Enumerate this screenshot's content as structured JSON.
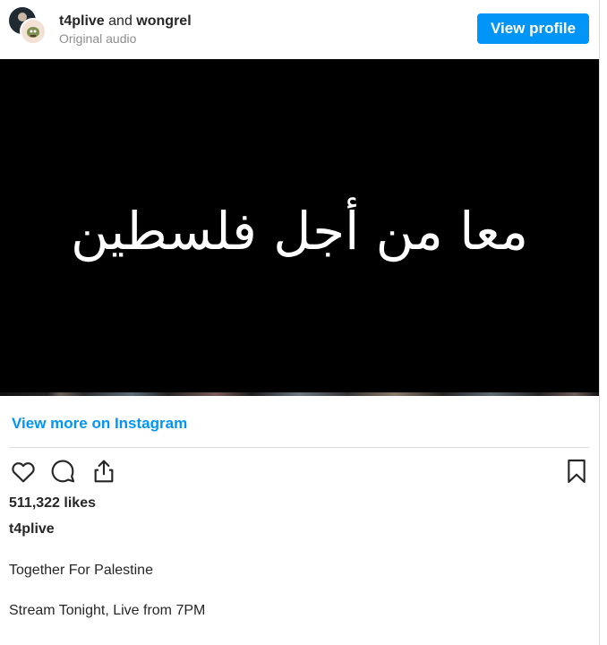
{
  "header": {
    "user1": "t4plive",
    "connector": "and",
    "user2": "wongrel",
    "subtitle": "Original audio",
    "view_profile_label": "View profile"
  },
  "media": {
    "overlay_text": "معا من أجل فلسطين"
  },
  "links": {
    "view_more": "View more on Instagram"
  },
  "actions": {
    "icons": [
      "heart-icon",
      "comment-icon",
      "share-icon",
      "bookmark-icon"
    ]
  },
  "post": {
    "likes": "511,322 likes",
    "username": "t4plive",
    "caption_lines": [
      "Together For Palestine",
      "Stream Tonight, Live from 7PM"
    ]
  },
  "colors": {
    "accent": "#0095f6",
    "text": "#262626",
    "muted": "#8e8e8e",
    "media_bg": "#000000"
  }
}
